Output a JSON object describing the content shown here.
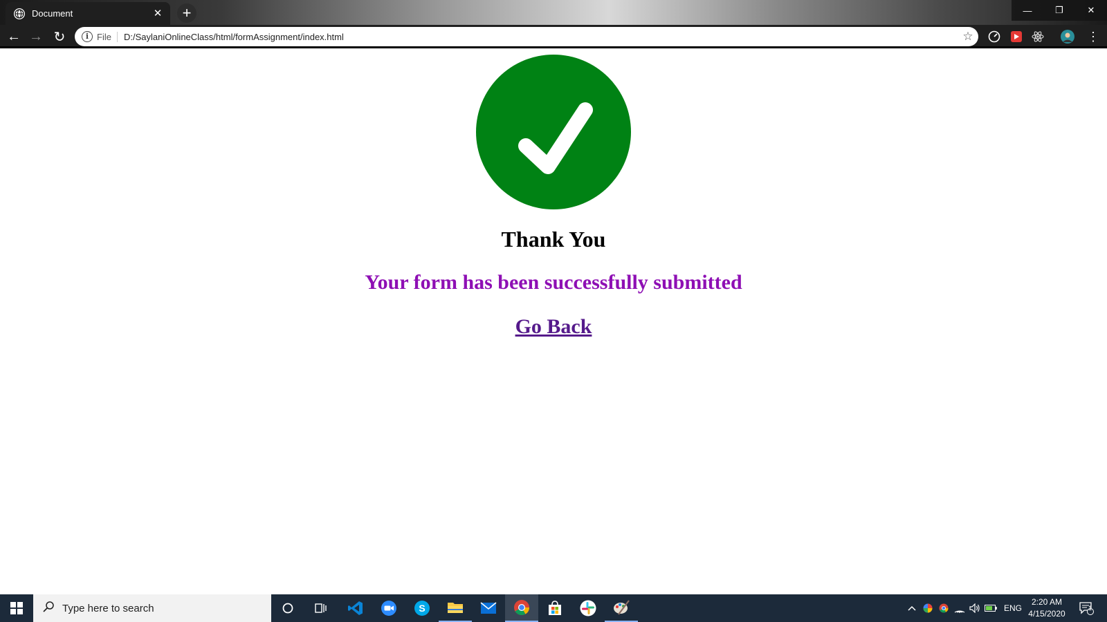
{
  "browser": {
    "tab_title": "Document",
    "tab_close": "✕",
    "new_tab": "+",
    "window_controls": {
      "minimize": "—",
      "restore": "❐",
      "close": "✕"
    },
    "nav": {
      "back": "←",
      "forward": "→",
      "reload": "↻"
    },
    "omnibox": {
      "scheme_label": "File",
      "url": "D:/SaylaniOnlineClass/html/formAssignment/index.html",
      "star": "☆"
    },
    "menu": "⋮"
  },
  "page": {
    "heading": "Thank You",
    "message": "Your form has been successfully submitted",
    "link": "Go Back",
    "colors": {
      "check": "#008214",
      "message": "#8e0fb4",
      "link": "#551a8b"
    }
  },
  "taskbar": {
    "search_placeholder": "Type here to search",
    "apps": [
      "cortana-icon",
      "task-view-icon",
      "vscode-icon",
      "zoom-icon",
      "skype-icon",
      "file-explorer-icon",
      "mail-icon",
      "chrome-icon",
      "store-icon",
      "slack-icon",
      "paint-icon"
    ],
    "tray": {
      "language": "ENG",
      "time": "2:20 AM",
      "date": "4/15/2020",
      "notifications_count": "1"
    }
  }
}
